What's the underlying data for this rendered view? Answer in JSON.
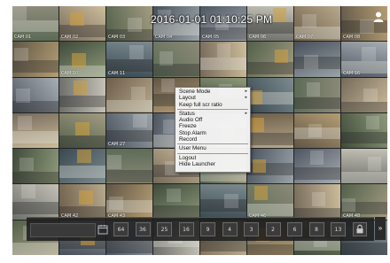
{
  "clock": {
    "datetime": "2016-01-01 01:10:25 PM"
  },
  "cameras": [
    "CAM 01",
    "CAM 02",
    "CAM 03",
    "CAM 04",
    "CAM 05",
    "CAM 06",
    "CAM 07",
    "CAM 08",
    "",
    "CAM 10",
    "CAM 11",
    "",
    "",
    "",
    "",
    "CAM 16",
    "",
    "",
    "",
    "",
    "",
    "",
    "",
    "",
    "",
    "",
    "CAM 27",
    "",
    "",
    "",
    "",
    "",
    "",
    "",
    "",
    "",
    "",
    "",
    "",
    "",
    "",
    "CAM 42",
    "CAM 43",
    "",
    "",
    "CAM 46",
    "",
    "CAM 48",
    "",
    "",
    "",
    "",
    "",
    "",
    "",
    ""
  ],
  "context_menu": {
    "items": [
      {
        "label": "Scene Mode",
        "submenu": true
      },
      {
        "label": "Layout",
        "submenu": true
      },
      {
        "label": "Keep full scr ratio",
        "submenu": false
      },
      {
        "separator": true
      },
      {
        "label": "Status",
        "submenu": true
      },
      {
        "label": "Audio Off",
        "submenu": false
      },
      {
        "label": "Freeze",
        "submenu": false
      },
      {
        "label": "Stop Alarm",
        "submenu": false
      },
      {
        "label": "Record",
        "submenu": false
      },
      {
        "separator": true
      },
      {
        "label": "User Menu",
        "submenu": false
      },
      {
        "separator": true
      },
      {
        "label": "Logout",
        "submenu": false
      },
      {
        "label": "Hide Launcher",
        "submenu": false
      }
    ]
  },
  "launcher": {
    "layout_buttons": [
      "64",
      "36",
      "25",
      "16",
      "9",
      "4",
      "3",
      "2",
      "6",
      "8",
      "13"
    ],
    "expand_label": "»"
  },
  "icons": {
    "user": "user-icon",
    "calendar": "calendar-icon",
    "lock": "lock-icon"
  }
}
